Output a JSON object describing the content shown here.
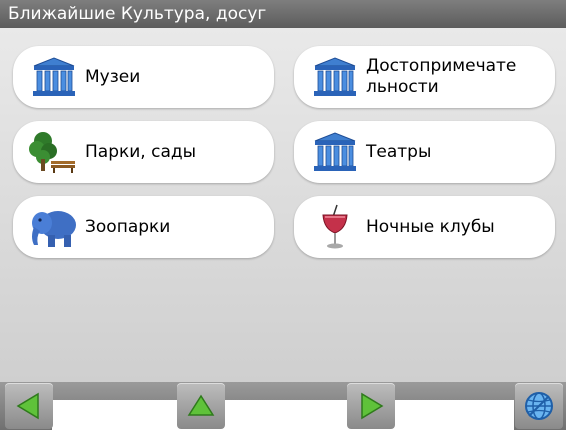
{
  "title": "Ближайшие Культура, досуг",
  "tiles": [
    {
      "label": "Музеи",
      "icon": "museum-building-icon"
    },
    {
      "label": "Достопримечательности",
      "label_line1": "Достопримечате",
      "label_line2": "льности",
      "icon": "landmark-building-icon"
    },
    {
      "label": "Парки, сады",
      "icon": "park-tree-bench-icon"
    },
    {
      "label": "Театры",
      "icon": "theatre-building-icon"
    },
    {
      "label": "Зоопарки",
      "icon": "elephant-icon"
    },
    {
      "label": "Ночные клубы",
      "icon": "cocktail-glass-icon"
    }
  ],
  "nav": {
    "back_icon": "arrow-left-icon",
    "up_icon": "arrow-up-icon",
    "forward_icon": "arrow-right-icon",
    "globe_icon": "globe-icon"
  },
  "colors": {
    "arrow_green": "#5fc23a",
    "title_bar": "#6e6e6e",
    "tile_bg": "#ffffff",
    "museum_blue": "#2a63b8"
  }
}
